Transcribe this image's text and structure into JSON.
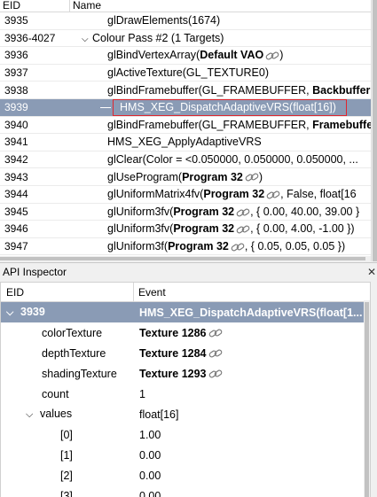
{
  "event_browser": {
    "header": {
      "eid": "EID",
      "name": "Name"
    },
    "rows": [
      {
        "eid": "3935",
        "name_prefix": "glDrawElements(1674)",
        "bold": "",
        "name_suffix": "",
        "link": false
      },
      {
        "eid": "3936-4027",
        "name_prefix": "Colour Pass #2 (1 Targets)",
        "bold": "",
        "name_suffix": "",
        "link": false,
        "expanded": true
      },
      {
        "eid": "3936",
        "name_prefix": "glBindVertexArray(",
        "bold": "Default VAO",
        "name_suffix": ")",
        "link": true
      },
      {
        "eid": "3937",
        "name_prefix": "glActiveTexture(GL_TEXTURE0)",
        "bold": "",
        "name_suffix": "",
        "link": false
      },
      {
        "eid": "3938",
        "name_prefix": "glBindFramebuffer(GL_FRAMEBUFFER, ",
        "bold": "Backbuffer",
        "name_suffix": "",
        "link": false
      },
      {
        "eid": "3939",
        "name_prefix": "HMS_XEG_DispatchAdaptiveVRS(float[16])",
        "bold": "",
        "name_suffix": "",
        "link": false,
        "selected": true
      },
      {
        "eid": "3940",
        "name_prefix": "glBindFramebuffer(GL_FRAMEBUFFER, ",
        "bold": "Framebuffer",
        "name_suffix": "",
        "link": false
      },
      {
        "eid": "3941",
        "name_prefix": "HMS_XEG_ApplyAdaptiveVRS",
        "bold": "",
        "name_suffix": "",
        "link": false
      },
      {
        "eid": "3942",
        "name_prefix": "glClear(Color = <0.050000, 0.050000, 0.050000, ...",
        "bold": "",
        "name_suffix": "",
        "link": false
      },
      {
        "eid": "3943",
        "name_prefix": "glUseProgram(",
        "bold": "Program 32",
        "name_suffix": ")",
        "link": true
      },
      {
        "eid": "3944",
        "name_prefix": "glUniformMatrix4fv(",
        "bold": "Program 32",
        "name_suffix": ", False, float[16",
        "link": true
      },
      {
        "eid": "3945",
        "name_prefix": "glUniform3fv(",
        "bold": "Program 32",
        "name_suffix": ", { 0.00, 40.00, 39.00 }",
        "link": true
      },
      {
        "eid": "3946",
        "name_prefix": "glUniform3fv(",
        "bold": "Program 32",
        "name_suffix": ", { 0.00, 4.00, -1.00 })",
        "link": true
      },
      {
        "eid": "3947",
        "name_prefix": "glUniform3f(",
        "bold": "Program 32",
        "name_suffix": ", { 0.05, 0.05, 0.05 })",
        "link": true
      }
    ]
  },
  "api_inspector": {
    "title": "API Inspector",
    "close_glyph": "✕",
    "header": {
      "eid": "EID",
      "event": "Event"
    },
    "selected": {
      "eid": "3939",
      "event": "HMS_XEG_DispatchAdaptiveVRS(float[1..."
    },
    "params": [
      {
        "name": "colorTexture",
        "value": "Texture 1286",
        "bold": true,
        "link": true
      },
      {
        "name": "depthTexture",
        "value": "Texture 1284",
        "bold": true,
        "link": true
      },
      {
        "name": "shadingTexture",
        "value": "Texture 1293",
        "bold": true,
        "link": true
      },
      {
        "name": "count",
        "value": "1",
        "bold": false,
        "link": false
      }
    ],
    "values_node": {
      "name": "values",
      "value": "float[16]"
    },
    "values": [
      {
        "index": "[0]",
        "value": "1.00"
      },
      {
        "index": "[1]",
        "value": "0.00"
      },
      {
        "index": "[2]",
        "value": "0.00"
      },
      {
        "index": "[3]",
        "value": "0.00"
      }
    ]
  }
}
